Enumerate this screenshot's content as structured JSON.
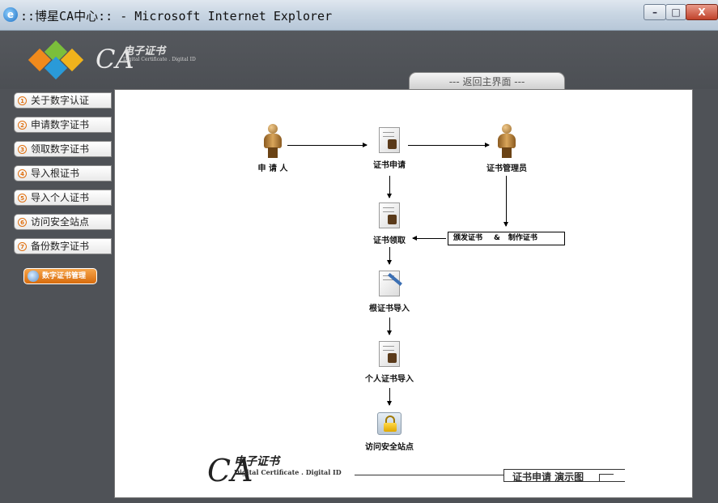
{
  "window": {
    "title": "::博星CA中心:: - Microsoft Internet Explorer",
    "min_glyph": "–",
    "max_glyph": "□",
    "close_glyph": "X"
  },
  "header": {
    "logo_ca": "CA",
    "logo_cn": "电子证书",
    "logo_en": "Digital Certificate . Digital ID",
    "home_tab": "--- 返回主界面 ---"
  },
  "sidebar": {
    "items": [
      {
        "num": "1",
        "label": "关于数字认证"
      },
      {
        "num": "2",
        "label": "申请数字证书"
      },
      {
        "num": "3",
        "label": "领取数字证书"
      },
      {
        "num": "4",
        "label": "导入根证书"
      },
      {
        "num": "5",
        "label": "导入个人证书"
      },
      {
        "num": "6",
        "label": "访问安全站点"
      },
      {
        "num": "7",
        "label": "备份数字证书"
      }
    ],
    "cert_manager": "数字证书管理"
  },
  "diagram": {
    "applicant": "申 请 人",
    "cert_apply": "证书申请",
    "cert_admin": "证书管理员",
    "cert_receive": "证书领取",
    "issue_cert": "颁发证书",
    "amp": "&",
    "make_cert": "制作证书",
    "import_root": "根证书导入",
    "import_personal": "个人证书导入",
    "visit_secure": "访问安全站点"
  },
  "footer": {
    "ca": "CA",
    "cn": "电子证书",
    "en": "Digital Certificate . Digital ID",
    "title": "证书申请 演示图"
  },
  "colors": {
    "background": "#4f5257",
    "accent_orange": "#e07010",
    "panel": "#ffffff"
  }
}
